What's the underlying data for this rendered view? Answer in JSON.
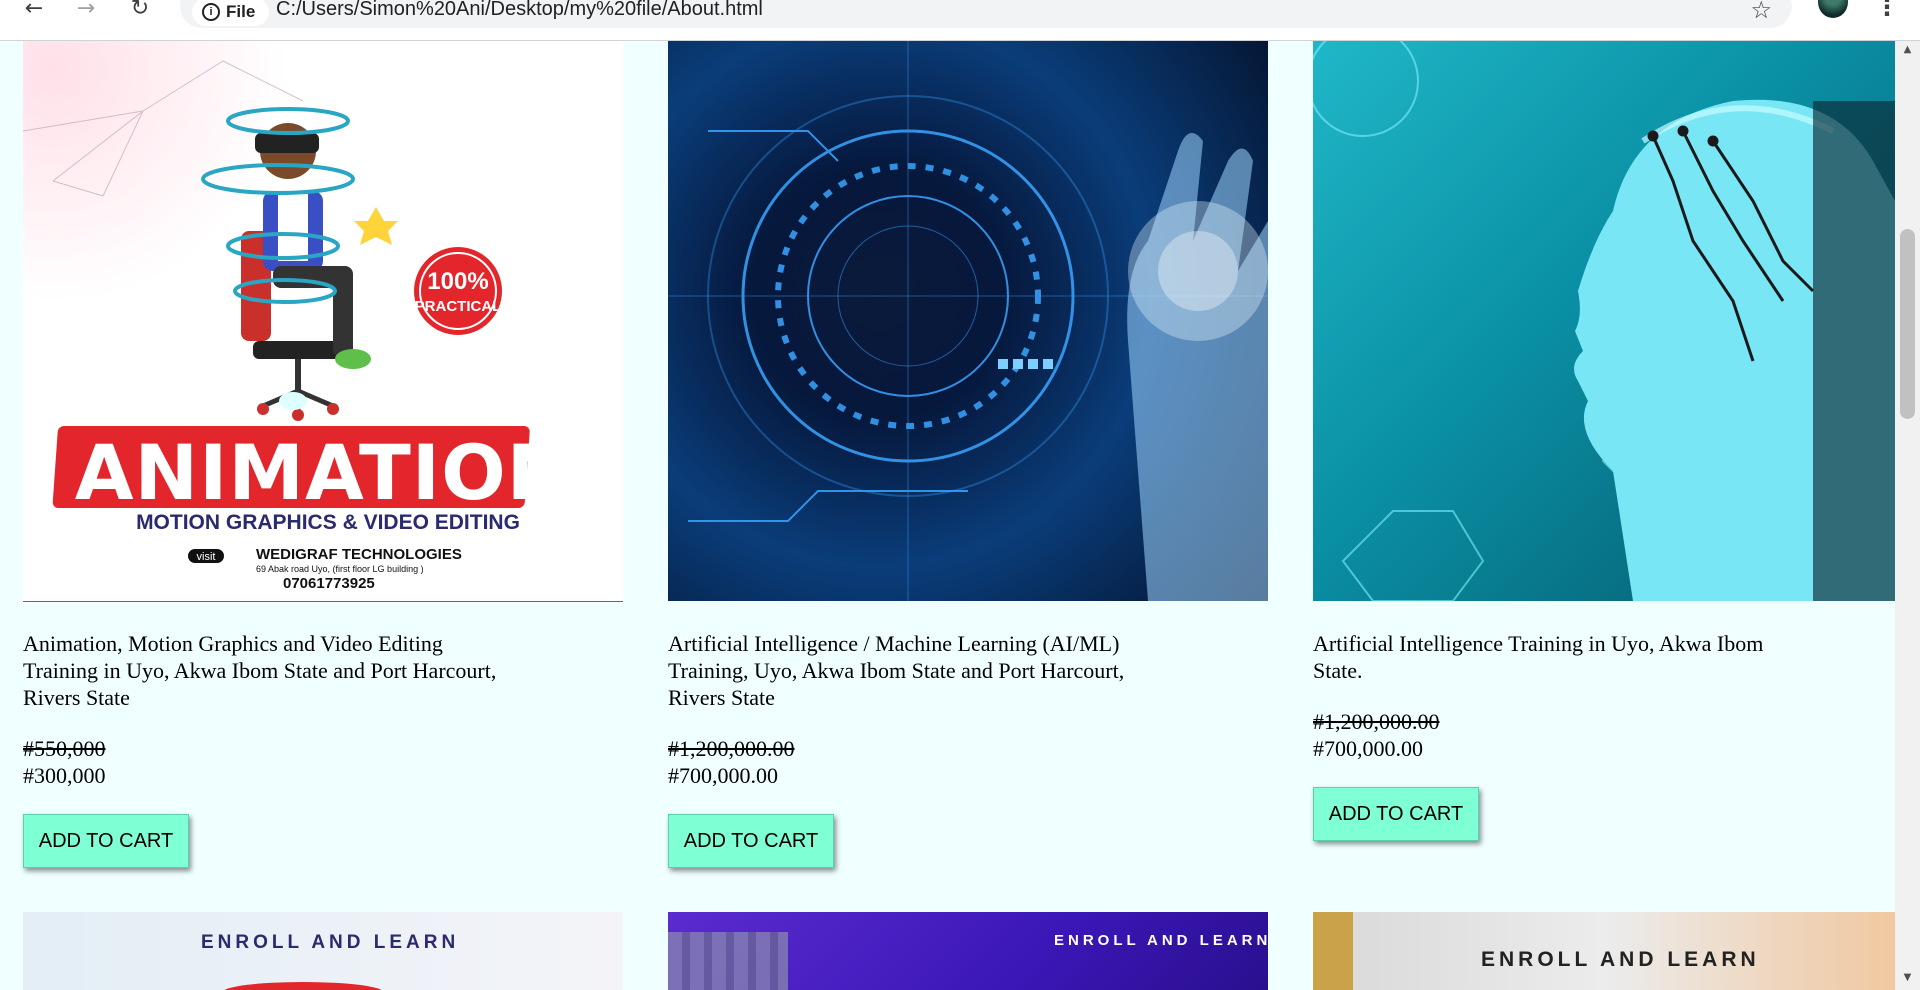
{
  "browser": {
    "site_info_label": "File",
    "url": "C:/Users/Simon%20Ani/Desktop/my%20file/About.html"
  },
  "cards": [
    {
      "title": "Animation, Motion Graphics and Video Editing Training in Uyo, Akwa Ibom State and Port Harcourt, Rivers State",
      "old_price": "#550,000",
      "new_price": "#300,000",
      "button": "ADD TO CART",
      "image": {
        "headline": "ANIMATION",
        "subline": "MOTION GRAPHICS & VIDEO EDITING",
        "badge_top": "100%",
        "badge_bottom": "PRACTICAL",
        "visit": "visit",
        "company": "WEDIGRAF TECHNOLOGIES",
        "address": "69 Abak road Uyo, (first floor LG building )",
        "phone": "07061773925"
      }
    },
    {
      "title": "Artificial Intelligence / Machine Learning (AI/ML) Training, Uyo, Akwa Ibom State and Port Harcourt, Rivers State",
      "old_price": "#1,200,000.00",
      "new_price": "#700,000.00",
      "button": "ADD TO CART"
    },
    {
      "title": "Artificial Intelligence Training in Uyo, Akwa Ibom State.",
      "old_price": "#1,200,000.00",
      "new_price": "#700,000.00",
      "button": "ADD TO CART"
    }
  ],
  "next_row": [
    {
      "label": "ENROLL AND LEARN"
    },
    {
      "label": "ENROLL AND LEARN"
    },
    {
      "label": "ENROLL AND LEARN"
    }
  ]
}
